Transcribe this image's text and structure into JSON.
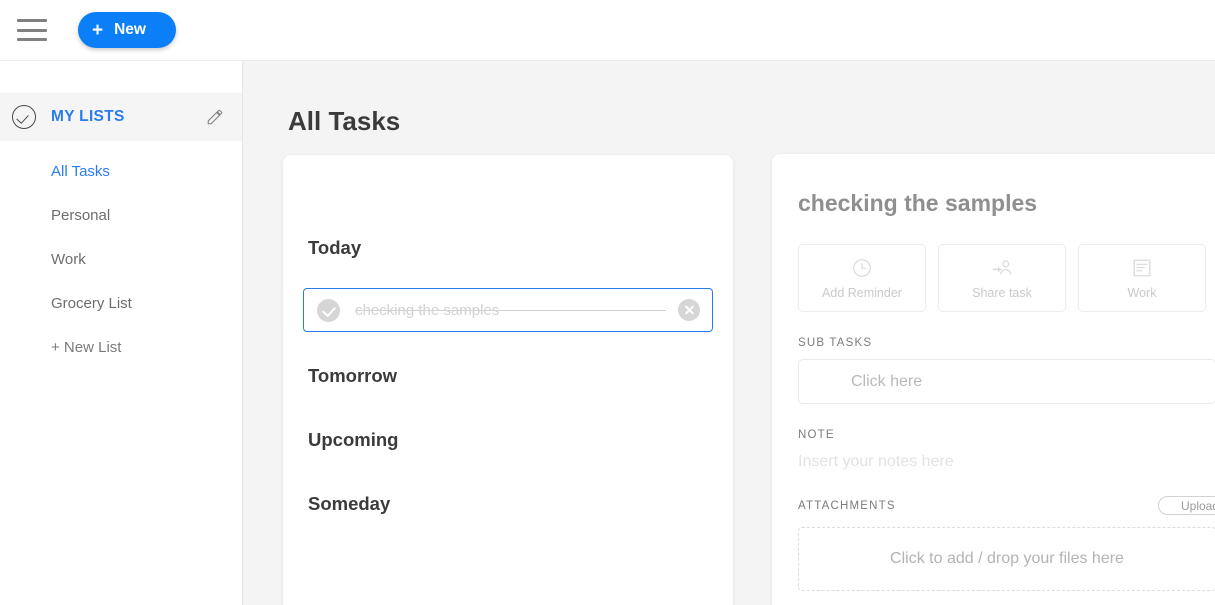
{
  "topbar": {
    "menu_icon": "hamburger-menu-icon",
    "new_button": {
      "plus": "+",
      "label": "New"
    }
  },
  "sidebar": {
    "header": {
      "icon": "check-circle-icon",
      "label": "MY LISTS",
      "edit_icon": "pencil-icon"
    },
    "items": [
      {
        "label": "All Tasks",
        "active": true
      },
      {
        "label": "Personal",
        "active": false
      },
      {
        "label": "Work",
        "active": false
      },
      {
        "label": "Grocery List",
        "active": false
      },
      {
        "label": "+ New List",
        "active": false
      }
    ]
  },
  "main": {
    "page_title": "All Tasks",
    "sections": [
      {
        "label": "Today"
      },
      {
        "label": "Tomorrow"
      },
      {
        "label": "Upcoming"
      },
      {
        "label": "Someday"
      }
    ],
    "task": {
      "text": "checking the samples",
      "completed": true,
      "check_icon": "check-circle-filled-icon",
      "delete_icon": "close-circle-icon"
    }
  },
  "detail": {
    "title": "checking the samples",
    "actions": [
      {
        "label": "Add Reminder",
        "icon": "clock-icon"
      },
      {
        "label": "Share task",
        "icon": "share-person-icon"
      },
      {
        "label": "Work",
        "icon": "note-lines-icon"
      }
    ],
    "subtasks": {
      "label": "SUB TASKS",
      "placeholder": "Click here"
    },
    "note": {
      "label": "NOTE",
      "placeholder": "Insert your notes here"
    },
    "attachments": {
      "label": "ATTACHMENTS",
      "upload_label": "Upload",
      "dropzone_text": "Click to add / drop your files here"
    }
  },
  "colors": {
    "accent_blue": "#0b7ff7",
    "link_blue": "#2a7bf0",
    "page_bg": "#f4f4f4",
    "muted_text": "#b9b9b9"
  }
}
